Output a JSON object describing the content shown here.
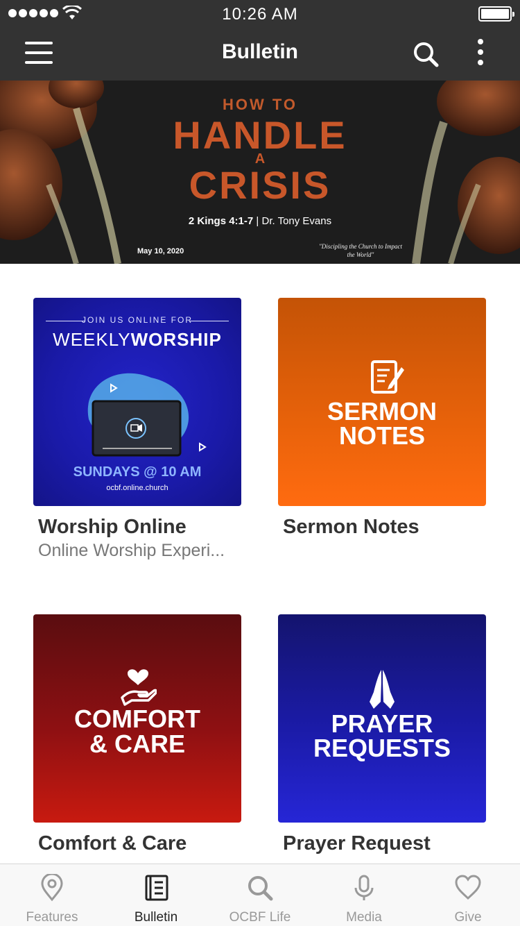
{
  "status_bar": {
    "time": "10:26 AM"
  },
  "nav": {
    "title": "Bulletin"
  },
  "hero": {
    "kicker": "HOW TO",
    "title_line1": "HANDLE",
    "title_a": "A",
    "title_line2": "CRISIS",
    "scripture": "2 Kings 4:1-7",
    "separator": "|",
    "speaker": "Dr. Tony Evans",
    "date": "May 10, 2020",
    "quote": "\"Discipling the Church to Impact the World\""
  },
  "cards": [
    {
      "title": "Worship Online",
      "subtitle": "Online Worship Experi...",
      "image": {
        "kicker": "JOIN US ONLINE FOR",
        "title_light": "WEEKLY",
        "title_bold": "WORSHIP",
        "schedule": "SUNDAYS @ 10 AM",
        "url": "ocbf.online.church"
      }
    },
    {
      "title": "Sermon Notes",
      "image": {
        "line1": "SERMON",
        "line2": "NOTES",
        "icon": "notes-edit-icon"
      }
    },
    {
      "title": "Comfort & Care",
      "image": {
        "line1": "COMFORT",
        "line2": "& CARE",
        "icon": "heart-hand-icon"
      }
    },
    {
      "title": "Prayer Request",
      "image": {
        "line1": "PRAYER",
        "line2": "REQUESTS",
        "icon": "praying-hands-icon"
      }
    }
  ],
  "tabs": [
    {
      "label": "Features",
      "icon": "location-pin-icon",
      "active": false
    },
    {
      "label": "Bulletin",
      "icon": "bulletin-book-icon",
      "active": true
    },
    {
      "label": "OCBF Life",
      "icon": "search-icon",
      "active": false
    },
    {
      "label": "Media",
      "icon": "microphone-icon",
      "active": false
    },
    {
      "label": "Give",
      "icon": "heart-icon",
      "active": false
    }
  ],
  "colors": {
    "header_bg": "#333333",
    "tab_active": "#222222",
    "tab_inactive": "#999999",
    "sermon_orange": "#e8620a",
    "comfort_red": "#8e1012",
    "prayer_blue": "#1b1ba8",
    "worship_blue": "#1a1aa8"
  }
}
